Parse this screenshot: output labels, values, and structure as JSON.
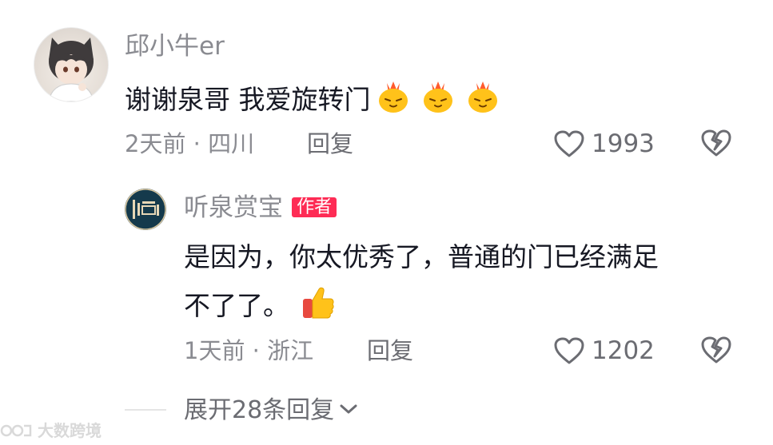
{
  "comment": {
    "username": "邱小牛er",
    "text": "谢谢泉哥 我爱旋转门",
    "emoji_icons": [
      "fire-chick-emoji",
      "fire-chick-emoji",
      "fire-chick-emoji"
    ],
    "time": "2天前",
    "separator": "·",
    "location": "四川",
    "reply_label": "回复",
    "like_count": "1993"
  },
  "reply": {
    "username": "听泉赏宝",
    "badge": "作者",
    "text_line1": "是因为，你太优秀了，普通的门已经满足",
    "text_line2": "不了了。",
    "emoji_icon": "thumbs-up-emoji",
    "time": "1天前",
    "separator": "·",
    "location": "浙江",
    "reply_label": "回复",
    "like_count": "1202"
  },
  "expand": {
    "label": "展开28条回复"
  },
  "watermark": {
    "text": "大数跨境"
  },
  "colors": {
    "badge_bg": "#fe2c55",
    "meta_text": "#8a8b91",
    "primary_text": "#161823"
  }
}
